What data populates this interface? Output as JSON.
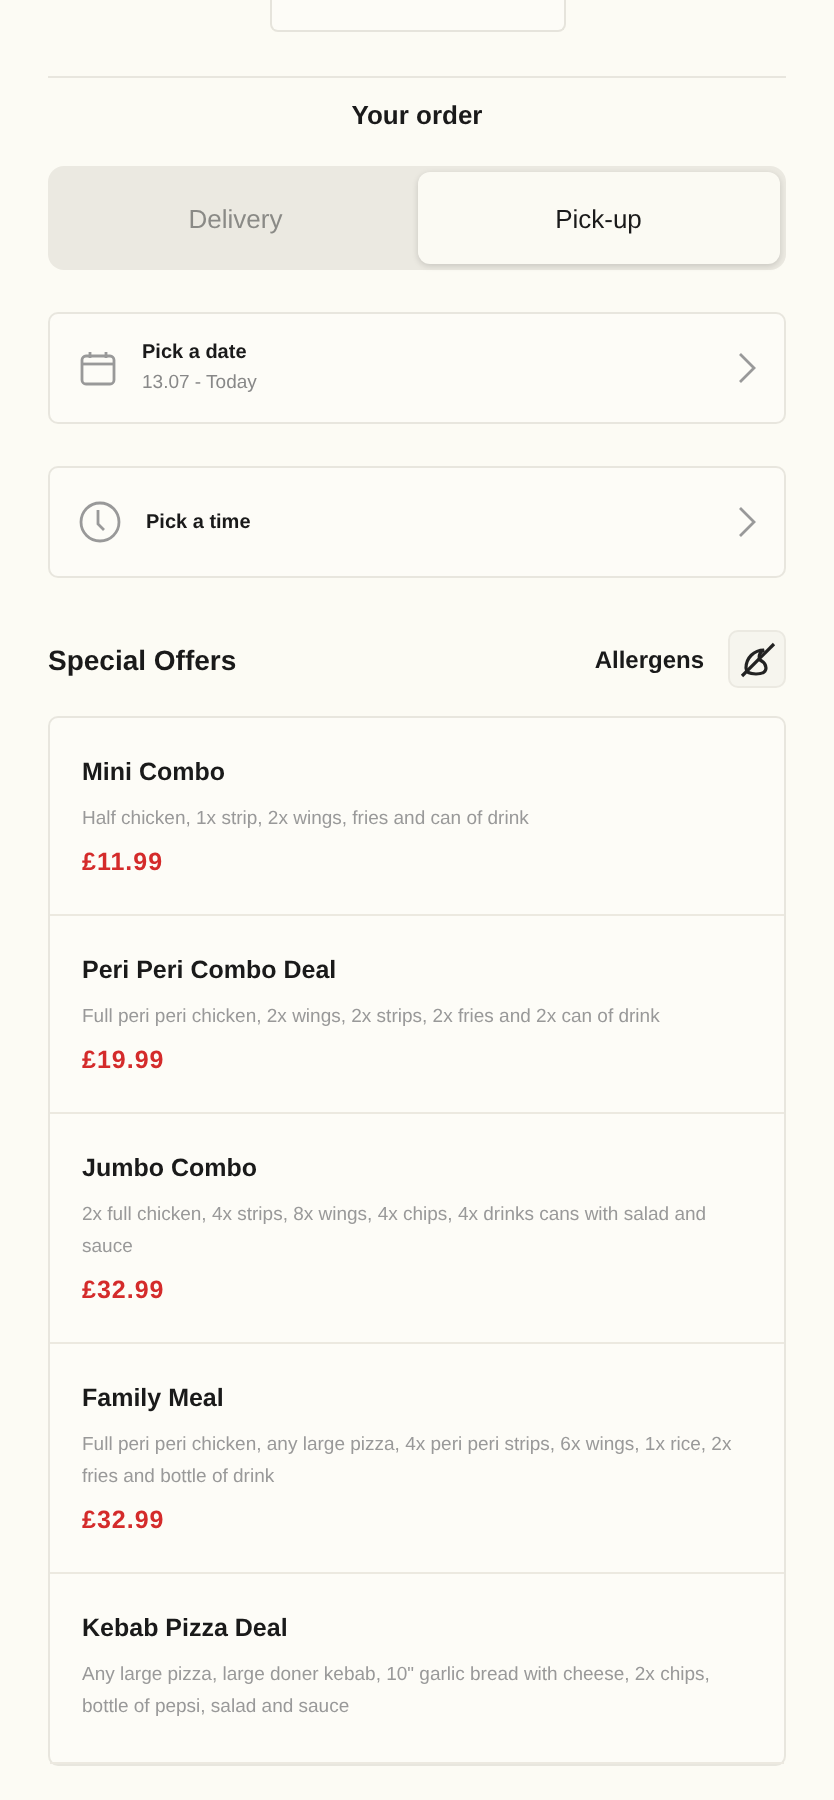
{
  "title": "Your order",
  "tabs": [
    {
      "label": "Delivery",
      "selected": false
    },
    {
      "label": "Pick-up",
      "selected": true
    }
  ],
  "pickers": [
    {
      "kind": "date",
      "label": "Pick a date",
      "value": "13.07 - Today"
    },
    {
      "kind": "time",
      "label": "Pick a time"
    }
  ],
  "offers_header": {
    "title": "Special Offers",
    "allergens": "Allergens"
  },
  "offers": [
    {
      "name": "Mini Combo",
      "description": "Half chicken, 1x strip, 2x wings, fries and can of drink",
      "price": "£11.99"
    },
    {
      "name": "Peri Peri Combo Deal",
      "description": "Full peri peri chicken, 2x wings, 2x strips, 2x fries and 2x can of drink",
      "price": "£19.99"
    },
    {
      "name": "Jumbo Combo",
      "description": "2x full chicken, 4x strips, 8x wings, 4x chips, 4x drinks cans with salad and sauce",
      "price": "£32.99"
    },
    {
      "name": "Family Meal",
      "description": "Full peri peri chicken, any large pizza, 4x peri peri strips, 6x wings, 1x rice, 2x fries and bottle of drink",
      "price": "£32.99"
    },
    {
      "name": "Kebab Pizza Deal",
      "description": "Any large pizza, large doner kebab, 10\" garlic bread with cheese, 2x chips, bottle of pepsi, salad and sauce"
    }
  ]
}
